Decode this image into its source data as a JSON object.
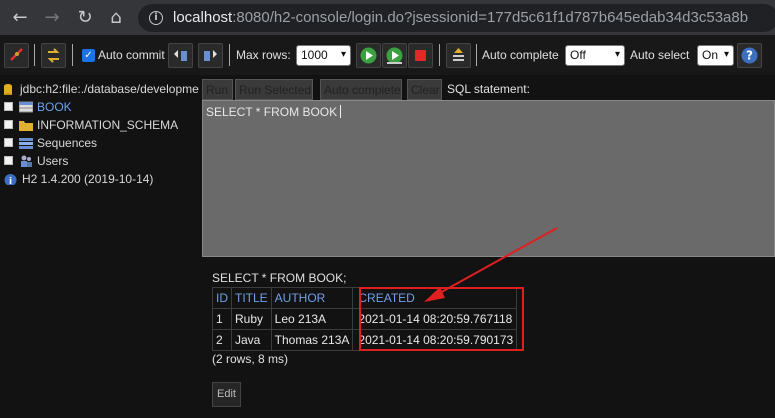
{
  "browser": {
    "url_host": "localhost",
    "url_rest": ":8080/h2-console/login.do?jsessionid=177d5c61f1d787b645edab34d3c53a8b"
  },
  "toolbar": {
    "auto_commit_label": "Auto commit",
    "auto_commit_checked": true,
    "max_rows_label": "Max rows:",
    "max_rows_value": "1000",
    "auto_complete_label": "Auto complete",
    "auto_complete_value": "Off",
    "auto_select_label": "Auto select",
    "auto_select_value": "On"
  },
  "tree": {
    "connection": "jdbc:h2:file:./database/developme",
    "items": [
      {
        "label": "BOOK"
      },
      {
        "label": "INFORMATION_SCHEMA"
      },
      {
        "label": "Sequences"
      },
      {
        "label": "Users"
      }
    ],
    "version": "H2 1.4.200 (2019-10-14)"
  },
  "sql": {
    "buttons": [
      "Run",
      "Run Selected",
      "Auto complete",
      "Clear"
    ],
    "label": "SQL statement:",
    "statement": "SELECT * FROM BOOK"
  },
  "results": {
    "title": "SELECT * FROM BOOK;",
    "columns": [
      "ID",
      "TITLE",
      "AUTHOR",
      "CREATED"
    ],
    "rows": [
      [
        "1",
        "Ruby",
        "Leo 213A",
        "2021-01-14 08:20:59.767118"
      ],
      [
        "2",
        "Java",
        "Thomas 213A",
        "2021-01-14 08:20:59.790173"
      ]
    ],
    "count": "(2 rows, 8 ms)",
    "edit_label": "Edit"
  },
  "annotation": {
    "color": "#e02020"
  }
}
